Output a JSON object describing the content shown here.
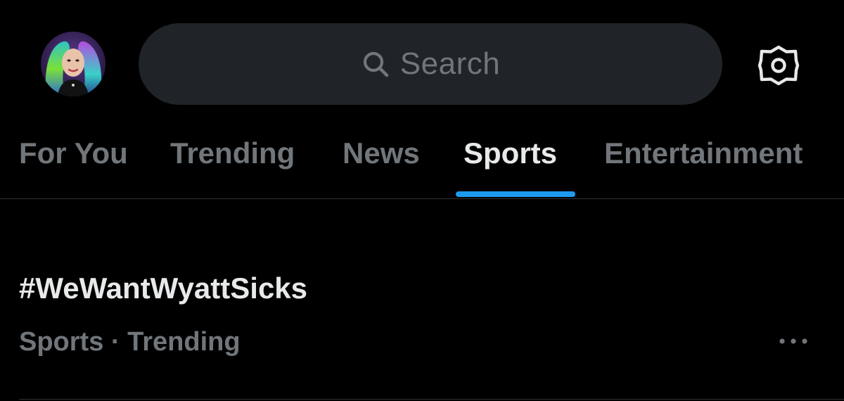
{
  "header": {
    "search": {
      "placeholder": "Search"
    }
  },
  "tabs": [
    {
      "label": "For You",
      "active": false
    },
    {
      "label": "Trending",
      "active": false
    },
    {
      "label": "News",
      "active": false
    },
    {
      "label": "Sports",
      "active": true
    },
    {
      "label": "Entertainment",
      "active": false
    }
  ],
  "trends": [
    {
      "title": "#WeWantWyattSicks",
      "meta": "Sports · Trending"
    }
  ],
  "icons": {
    "avatar": "user-avatar",
    "search": "search-icon",
    "settings": "gear-icon",
    "more": "more-horizontal-icon"
  },
  "colors": {
    "background": "#000000",
    "search_bg": "#202327",
    "primary_text": "#e7e9ea",
    "secondary_text": "#71767b",
    "accent": "#1d9bf0",
    "divider": "#2f3336"
  }
}
